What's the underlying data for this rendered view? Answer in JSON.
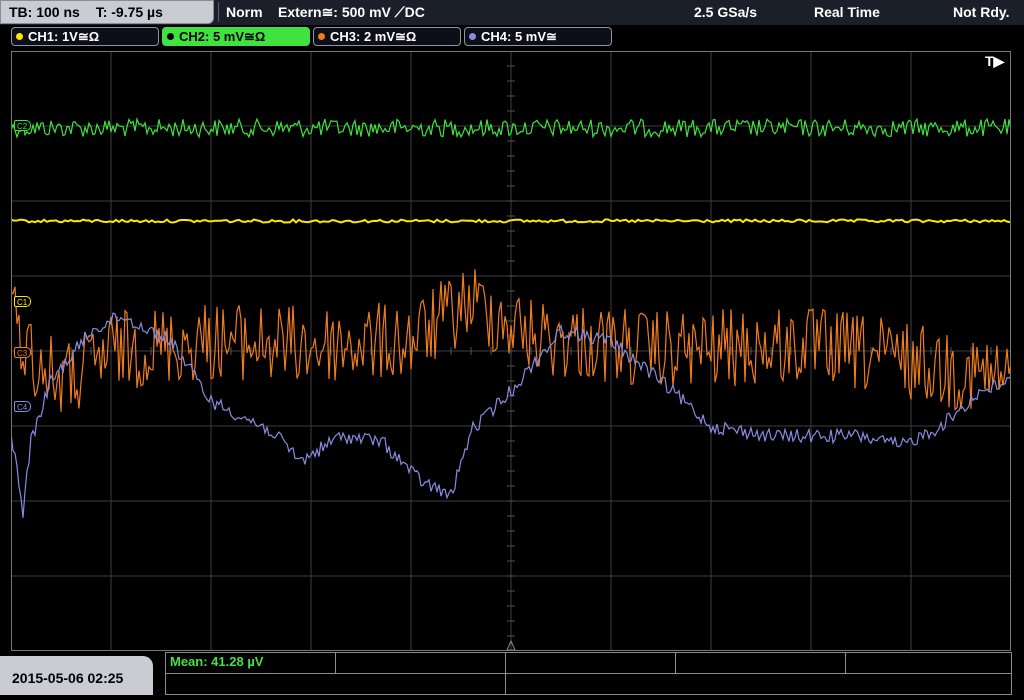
{
  "status": {
    "timebase": "TB: 100 ns",
    "trigger_pos": "T: -9.75 µs",
    "mode": "Norm",
    "trigger_source": "Extern≅: 500 mV ⟋DC",
    "sample_rate": "2.5 GSa/s",
    "acq_mode": "Real Time",
    "ready_state": "Not Rdy."
  },
  "channels": [
    {
      "label": "CH1: 1V≅Ω",
      "color": "#ffe800",
      "active": false
    },
    {
      "label": "CH2: 5 mV≅Ω",
      "color": "#3fe23f",
      "active": true
    },
    {
      "label": "CH3: 2 mV≅Ω",
      "color": "#f07c1e",
      "active": false
    },
    {
      "label": "CH4: 5 mV≅",
      "color": "#8a8ae0",
      "active": false
    }
  ],
  "markers": {
    "c1": "C1",
    "c3": "C3",
    "c4": "C4",
    "c2": "C2",
    "trigger": "T▶"
  },
  "measurement": {
    "mean": "Mean: 41.28 µV"
  },
  "datetime": "2015-05-06 02:25",
  "colors": {
    "grid": "#3e3e3e",
    "ch1": "#ffe800",
    "ch2": "#3fe23f",
    "ch3": "#f07c1e",
    "ch4": "#8a8ae0"
  }
}
